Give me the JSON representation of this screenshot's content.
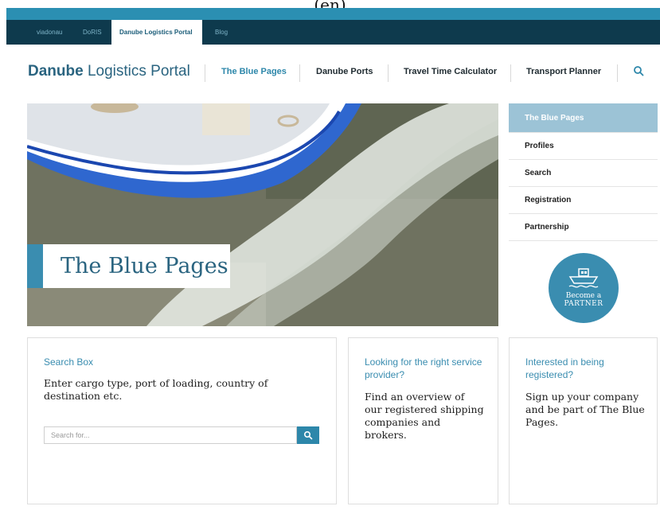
{
  "caption": "(en)",
  "topbar": {
    "tabs": [
      {
        "label": "viadonau"
      },
      {
        "label": "DoRIS"
      },
      {
        "label": "Danube Logistics Portal"
      },
      {
        "label": "Blog"
      }
    ]
  },
  "header": {
    "logo_bold": "Danube",
    "logo_rest": " Logistics Portal",
    "nav": [
      {
        "label": "The Blue Pages"
      },
      {
        "label": "Danube Ports"
      },
      {
        "label": "Travel Time Calculator"
      },
      {
        "label": "Transport Planner"
      }
    ],
    "search_icon": "search-icon"
  },
  "hero": {
    "title": "The Blue Pages"
  },
  "sidebar": {
    "items": [
      {
        "label": "The Blue Pages"
      },
      {
        "label": "Profiles"
      },
      {
        "label": "Search"
      },
      {
        "label": "Registration"
      },
      {
        "label": "Partnership"
      }
    ],
    "partner_line1": "Become a",
    "partner_line2": "PARTNER",
    "partner_icon": "ship-icon"
  },
  "cards": {
    "search": {
      "title": "Search Box",
      "body": "Enter cargo type, port of loading, country of destination etc.",
      "placeholder": "Search for...",
      "button_icon": "search-icon"
    },
    "provider": {
      "title": "Looking for the right service provider?",
      "body": "Find an overview of our registered shipping companies and brokers."
    },
    "register": {
      "title": "Interested in being registered?",
      "body": "Sign up your company and be part of The Blue Pages."
    }
  },
  "colors": {
    "accent": "#3a8db0",
    "topbar": "#0e3a4d",
    "sidebar_active": "#9cc3d6"
  }
}
